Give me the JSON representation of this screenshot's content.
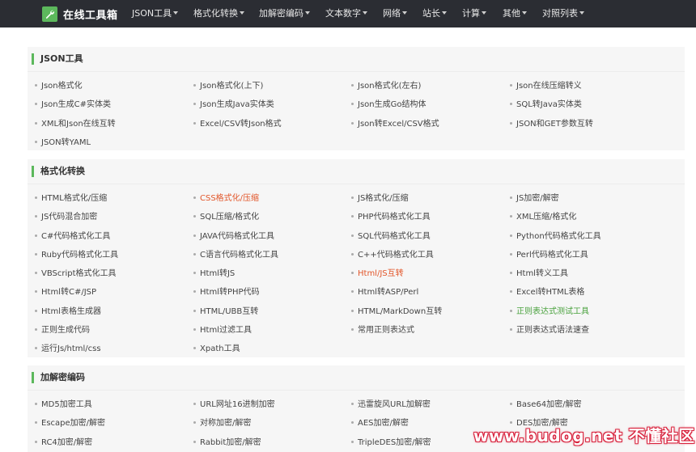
{
  "header": {
    "logo_text": "在线工具箱",
    "nav": [
      {
        "label": "JSON工具"
      },
      {
        "label": "格式化转换"
      },
      {
        "label": "加解密编码"
      },
      {
        "label": "文本数字"
      },
      {
        "label": "网络"
      },
      {
        "label": "站长"
      },
      {
        "label": "计算"
      },
      {
        "label": "其他"
      },
      {
        "label": "对照列表"
      }
    ]
  },
  "sections": [
    {
      "title": "JSON工具",
      "links": [
        "Json格式化",
        "Json格式化(上下)",
        "Json格式化(左右)",
        "Json在线压缩转义",
        "Json生成C#实体类",
        "Json生成Java实体类",
        "Json生成Go结构体",
        "SQL转Java实体类",
        "XML和Json在线互转",
        "Excel/CSV转Json格式",
        "Json转Excel/CSV格式",
        "JSON和GET参数互转",
        "JSON转YAML"
      ]
    },
    {
      "title": "格式化转换",
      "links": [
        "HTML格式化/压缩",
        "CSS格式化/压缩",
        "JS格式化/压缩",
        "JS加密/解密",
        "JS代码混合加密",
        "SQL压缩/格式化",
        "PHP代码格式化工具",
        "XML压缩/格式化",
        "C#代码格式化工具",
        "JAVA代码格式化工具",
        "SQL代码格式化工具",
        "Python代码格式化工具",
        "Ruby代码格式化工具",
        "C语言代码格式化工具",
        "C++代码格式化工具",
        "Perl代码格式化工具",
        "VBScript格式化工具",
        "Html转JS",
        "Html/JS互转",
        "Html转义工具",
        "Html转C#/JSP",
        "Html转PHP代码",
        "Html转ASP/Perl",
        "Excel转HTML表格",
        "Html表格生成器",
        "HTML/UBB互转",
        "HTML/MarkDown互转",
        "正则表达式测试工具",
        "正则生成代码",
        "Html过滤工具",
        "常用正则表达式",
        "正则表达式语法速查",
        "运行Js/html/css",
        "Xpath工具"
      ]
    },
    {
      "title": "加解密编码",
      "links": [
        "MD5加密工具",
        "URL网址16进制加密",
        "迅雷旋风URL加解密",
        "Base64加密/解密",
        "Escape加密/解密",
        "对称加密/解密",
        "AES加密/解密",
        "DES加密/解密",
        "RC4加密/解密",
        "Rabbit加密/解密",
        "TripleDES加密/解密"
      ]
    }
  ],
  "highlight_colors": {
    "orange": "#e2562a",
    "green": "#4aa23e"
  },
  "watermark": {
    "text": "www.budog.net 不懂社区"
  }
}
